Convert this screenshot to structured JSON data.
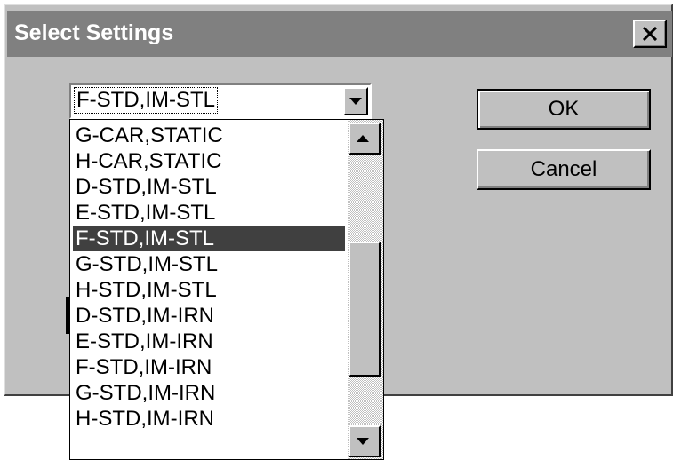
{
  "dialog": {
    "title": "Select Settings",
    "close_icon": "close-x-icon"
  },
  "combo": {
    "value": "F-STD,IM-STL",
    "dropdown_icon": "chevron-down-icon"
  },
  "buttons": {
    "ok_label": "OK",
    "cancel_label": "Cancel"
  },
  "dropdown_list": {
    "items": [
      "G-CAR,STATIC",
      "H-CAR,STATIC",
      "D-STD,IM-STL",
      "E-STD,IM-STL",
      "F-STD,IM-STL",
      "G-STD,IM-STL",
      "H-STD,IM-STL",
      "D-STD,IM-IRN",
      "E-STD,IM-IRN",
      "F-STD,IM-IRN",
      "G-STD,IM-IRN",
      "H-STD,IM-IRN"
    ],
    "selected_index": 4,
    "scroll_up_icon": "scroll-up-arrow-icon",
    "scroll_down_icon": "scroll-down-arrow-icon"
  },
  "colors": {
    "dialog_face": "#c0c0c0",
    "titlebar": "#808080",
    "selection": "#404040"
  }
}
